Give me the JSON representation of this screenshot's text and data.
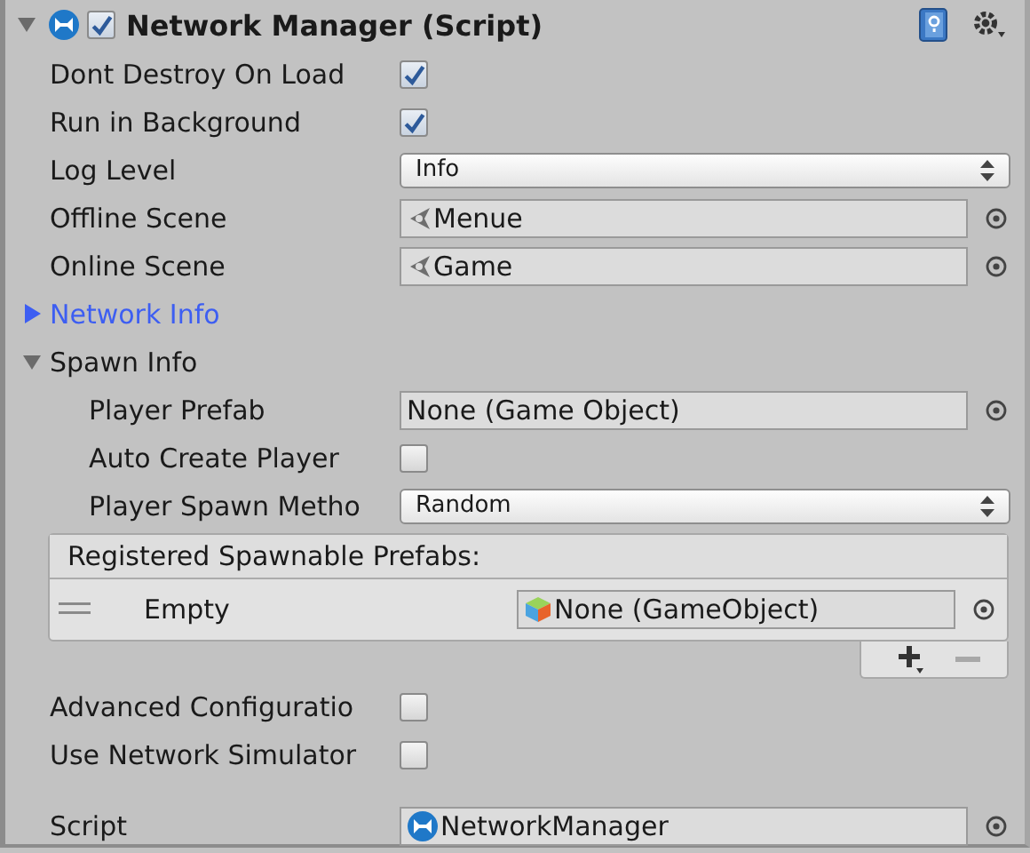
{
  "component": {
    "title": "Network Manager (Script)",
    "enabled": true,
    "expanded": true
  },
  "properties": [
    {
      "kind": "toggle",
      "label": "Dont Destroy On Load",
      "checked": true
    },
    {
      "kind": "toggle",
      "label": "Run in Background",
      "checked": true
    },
    {
      "kind": "dropdown",
      "label": "Log Level",
      "value": "Info"
    },
    {
      "kind": "scene",
      "label": "Offline Scene",
      "value": "Menue"
    },
    {
      "kind": "scene",
      "label": "Online Scene",
      "value": "Game"
    },
    {
      "kind": "foldout",
      "label": "Network Info",
      "expanded": false,
      "selected": true
    },
    {
      "kind": "foldout",
      "label": "Spawn Info",
      "expanded": true,
      "selected": false,
      "children": [
        {
          "kind": "object",
          "label": "Player Prefab",
          "value": "None (Game Object)"
        },
        {
          "kind": "toggle",
          "label": "Auto Create Player",
          "checked": false
        },
        {
          "kind": "dropdown",
          "label": "Player Spawn Metho",
          "value": "Random"
        }
      ]
    }
  ],
  "spawnable_prefabs": {
    "title": "Registered Spawnable Prefabs:",
    "items": [
      {
        "label": "Empty",
        "value": "None (GameObject)"
      }
    ],
    "buttons": [
      {
        "kind": "add",
        "disabled": false
      },
      {
        "kind": "remove",
        "disabled": true
      }
    ]
  },
  "options": [
    {
      "kind": "toggle",
      "label": "Advanced Configuratio",
      "checked": false
    },
    {
      "kind": "toggle",
      "label": "Use Network Simulator",
      "checked": false
    }
  ],
  "script": {
    "kind": "script",
    "label": "Script",
    "value": "NetworkManager"
  }
}
